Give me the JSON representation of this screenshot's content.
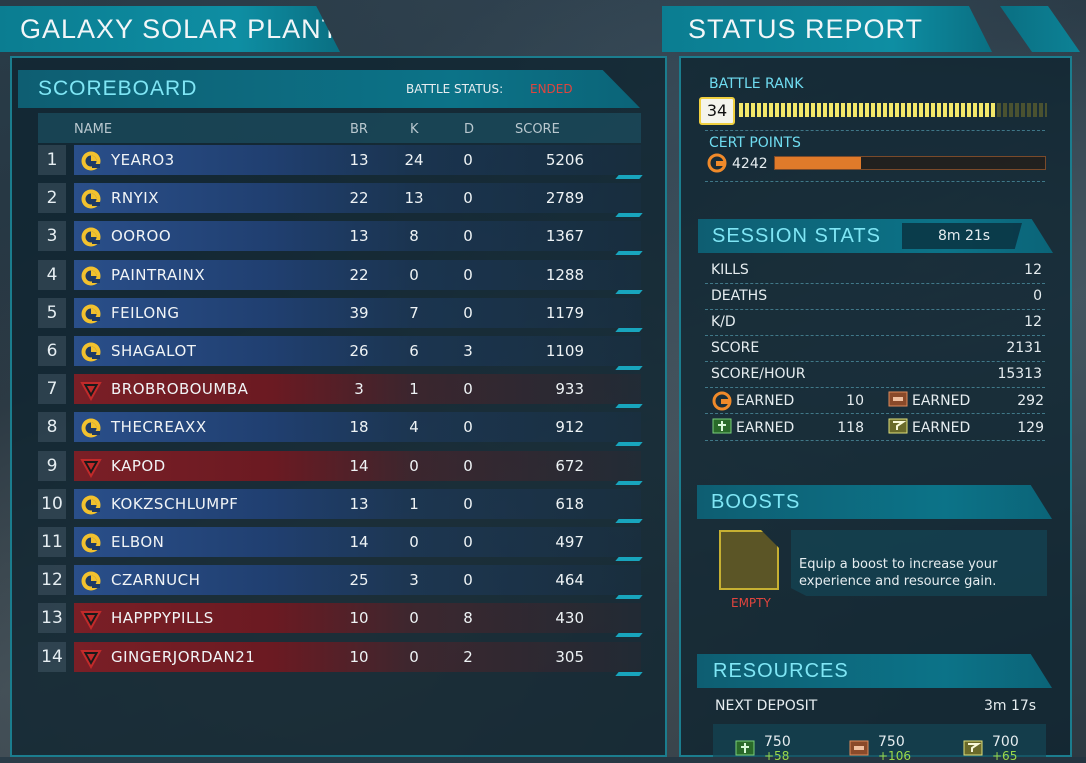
{
  "left_title": "GALAXY SOLAR PLANT",
  "right_title": "STATUS REPORT",
  "scoreboard": {
    "title": "SCOREBOARD",
    "battle_status_label": "BATTLE STATUS:",
    "battle_status_value": "ENDED",
    "columns": {
      "name": "NAME",
      "br": "BR",
      "k": "K",
      "d": "D",
      "score": "SCORE"
    },
    "rows": [
      {
        "rank": "1",
        "faction": "nc",
        "name": "YEARO3",
        "br": "13",
        "k": "24",
        "d": "0",
        "score": "5206"
      },
      {
        "rank": "2",
        "faction": "nc",
        "name": "RNYIX",
        "br": "22",
        "k": "13",
        "d": "0",
        "score": "2789"
      },
      {
        "rank": "3",
        "faction": "nc",
        "name": "OOROO",
        "br": "13",
        "k": "8",
        "d": "0",
        "score": "1367"
      },
      {
        "rank": "4",
        "faction": "nc",
        "name": "PAINTRAINX",
        "br": "22",
        "k": "0",
        "d": "0",
        "score": "1288"
      },
      {
        "rank": "5",
        "faction": "nc",
        "name": "FEILONG",
        "br": "39",
        "k": "7",
        "d": "0",
        "score": "1179"
      },
      {
        "rank": "6",
        "faction": "nc",
        "name": "SHAGALOT",
        "br": "26",
        "k": "6",
        "d": "3",
        "score": "1109"
      },
      {
        "rank": "7",
        "faction": "tr",
        "name": "BROBROBOUMBA",
        "br": "3",
        "k": "1",
        "d": "0",
        "score": "933"
      },
      {
        "rank": "8",
        "faction": "nc",
        "name": "THECREAXX",
        "br": "18",
        "k": "4",
        "d": "0",
        "score": "912"
      },
      {
        "rank": "9",
        "faction": "tr",
        "name": "KAPOD",
        "br": "14",
        "k": "0",
        "d": "0",
        "score": "672"
      },
      {
        "rank": "10",
        "faction": "nc",
        "name": "KOKZSCHLUMPF",
        "br": "13",
        "k": "1",
        "d": "0",
        "score": "618"
      },
      {
        "rank": "11",
        "faction": "nc",
        "name": "ELBON",
        "br": "14",
        "k": "0",
        "d": "0",
        "score": "497"
      },
      {
        "rank": "12",
        "faction": "nc",
        "name": "CZARNUCH",
        "br": "25",
        "k": "3",
        "d": "0",
        "score": "464"
      },
      {
        "rank": "13",
        "faction": "tr",
        "name": "HAPPPYPILLS",
        "br": "10",
        "k": "0",
        "d": "8",
        "score": "430"
      },
      {
        "rank": "14",
        "faction": "tr",
        "name": "GINGERJORDAN21",
        "br": "10",
        "k": "0",
        "d": "2",
        "score": "305"
      }
    ]
  },
  "status": {
    "battle_rank_label": "BATTLE RANK",
    "battle_rank_value": "34",
    "battle_rank_progress": 0.83,
    "cert_points_label": "CERT POINTS",
    "cert_points_value": "4242",
    "cert_progress": 0.32,
    "session_title": "SESSION STATS",
    "session_time": "8m 21s",
    "stats": [
      {
        "label": "KILLS",
        "value": "12"
      },
      {
        "label": "DEATHS",
        "value": "0"
      },
      {
        "label": "K/D",
        "value": "12"
      },
      {
        "label": "SCORE",
        "value": "2131"
      },
      {
        "label": "SCORE/HOUR",
        "value": "15313"
      }
    ],
    "earned": [
      {
        "icon": "cert-icon",
        "label": "EARNED",
        "value": "10"
      },
      {
        "icon": "mechanized-resource-icon",
        "label": "EARNED",
        "value": "292"
      },
      {
        "icon": "infantry-resource-icon",
        "label": "EARNED",
        "value": "118"
      },
      {
        "icon": "aerospace-resource-icon",
        "label": "EARNED",
        "value": "129"
      }
    ],
    "boosts_title": "BOOSTS",
    "boost_slot_label": "EMPTY",
    "boost_text": "Equip a boost to increase your experience and resource gain.",
    "resources_title": "RESOURCES",
    "next_deposit_label": "NEXT DEPOSIT",
    "next_deposit_time": "3m 17s",
    "deposits": [
      {
        "icon": "infantry-resource-icon",
        "value": "750",
        "bonus": "+58"
      },
      {
        "icon": "mechanized-resource-icon",
        "value": "750",
        "bonus": "+106"
      },
      {
        "icon": "aerospace-resource-icon",
        "value": "700",
        "bonus": "+65"
      }
    ]
  },
  "colors": {
    "accent": "#18a5bd",
    "nc": "#2a4f8a",
    "tr": "#7a1f26",
    "ended": "#e0453e",
    "gold": "#f0d040",
    "orange": "#e07a2a"
  }
}
